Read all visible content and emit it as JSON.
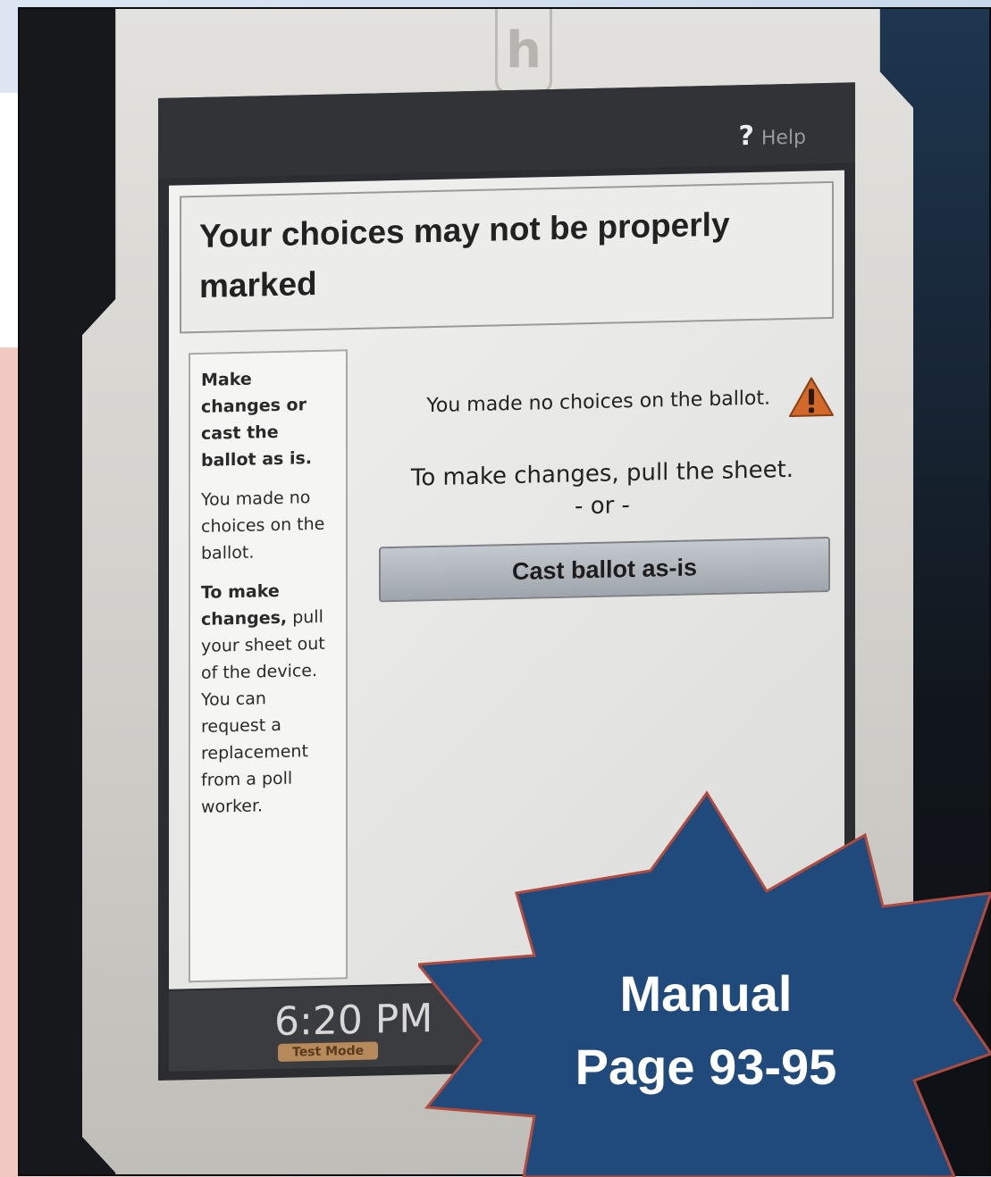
{
  "help": {
    "symbol": "?",
    "label": "Help"
  },
  "header": {
    "title": "Your choices may not be properly marked"
  },
  "sidebar": {
    "heading": "Make changes or cast the ballot as is.",
    "message": "You made no choices on the ballot.",
    "instruction_bold": "To make changes,",
    "instruction_rest": "pull your sheet out of the device. You can request a replacement from a poll worker."
  },
  "main": {
    "message": "You made no choices on the ballot.",
    "instruction": "To make changes, pull the sheet.",
    "separator": "- or -",
    "cast_button_label": "Cast ballot as-is",
    "warning_icon": "warning-triangle-icon"
  },
  "footer": {
    "time": "6:20 PM",
    "mode_badge": "Test Mode"
  },
  "callout": {
    "line1": "Manual",
    "line2": "Page 93-95",
    "color": "#204a7c"
  },
  "colors": {
    "warning": "#d2692a",
    "screen": "#2b2d30"
  }
}
